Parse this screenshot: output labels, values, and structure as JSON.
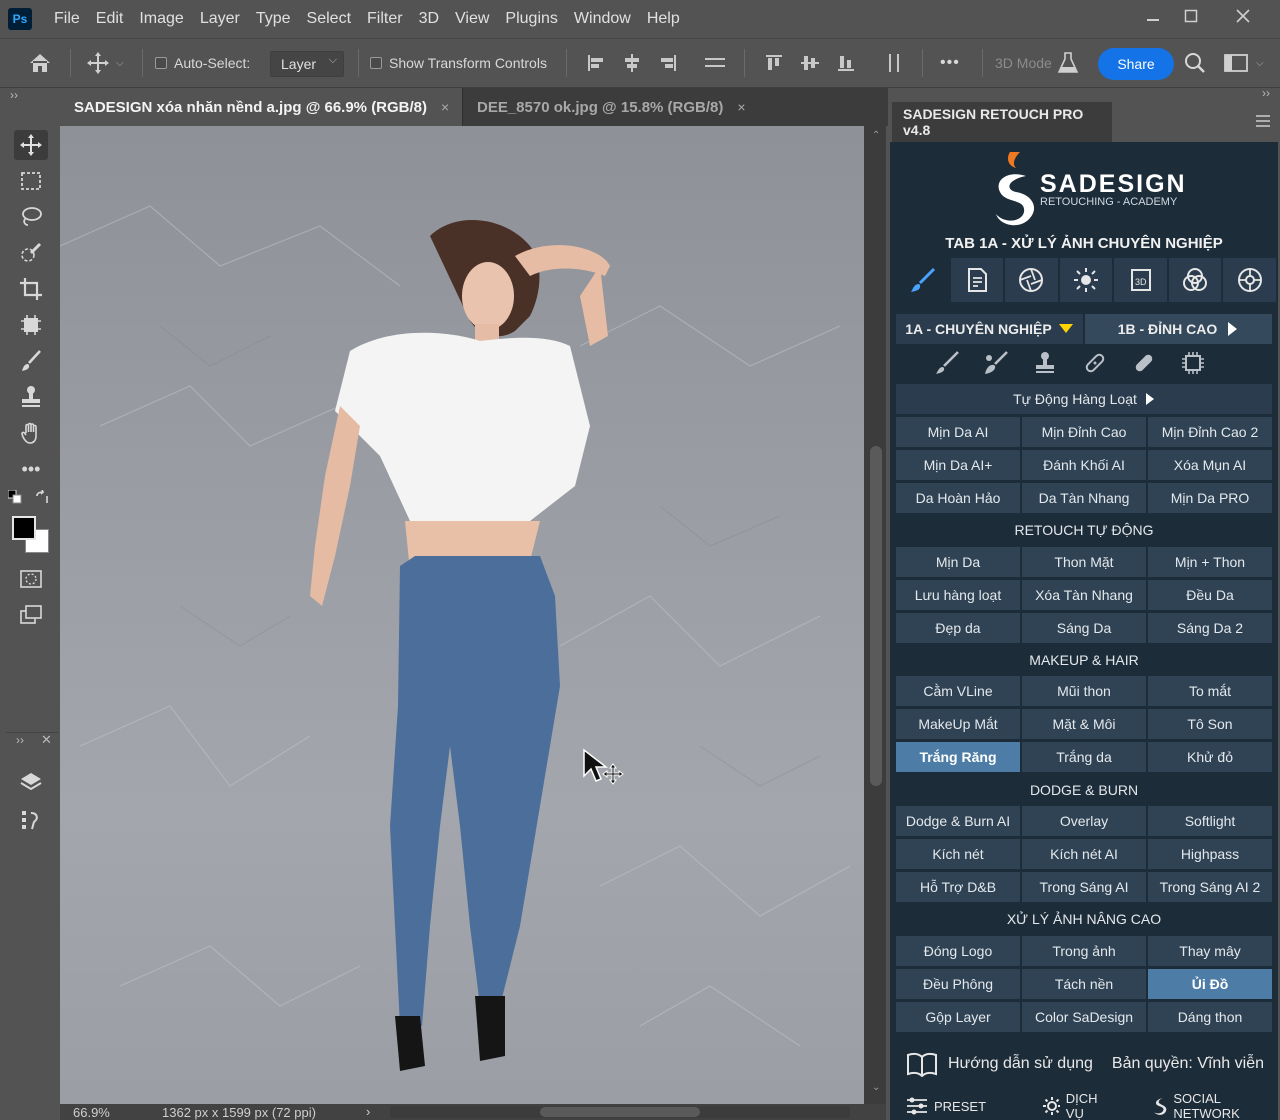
{
  "menubar": {
    "logo": "Ps",
    "items": [
      "File",
      "Edit",
      "Image",
      "Layer",
      "Type",
      "Select",
      "Filter",
      "3D",
      "View",
      "Plugins",
      "Window",
      "Help"
    ]
  },
  "options": {
    "auto_select": "Auto-Select:",
    "layer_dropdown": "Layer",
    "show_transform": "Show Transform Controls",
    "more": "•••",
    "mode_3d": "3D Mode",
    "share": "Share"
  },
  "tabs": [
    {
      "label": "SADESIGN xóa nhăn nềnd a.jpg @ 66.9% (RGB/8)",
      "close": "×"
    },
    {
      "label": "DEE_8570 ok.jpg @ 15.8% (RGB/8)",
      "close": "×"
    }
  ],
  "status": {
    "zoom": "66.9%",
    "dims": "1362 px x 1599 px (72 ppi)",
    "arrow": "›"
  },
  "panel": {
    "title": "SADESIGN RETOUCH PRO v4.8",
    "brand": "SADESIGN",
    "brand_sub": "RETOUCHING - ACADEMY",
    "tab_title": "TAB 1A - XỬ LÝ ẢNH CHUYÊN NGHIỆP",
    "subtab_a": "1A - CHUYÊN NGHIỆP",
    "subtab_b": "1B - ĐỈNH CAO",
    "auto_batch": "Tự Động Hàng Loạt",
    "rows1": [
      [
        "Mịn Da AI",
        "Mịn Đỉnh Cao",
        "Mịn Đỉnh Cao 2"
      ],
      [
        "Mịn Da AI+",
        "Đánh Khối AI",
        "Xóa Mụn AI"
      ],
      [
        "Da Hoàn Hảo",
        "Da Tàn Nhang",
        "Mịn Da PRO"
      ]
    ],
    "sec_retouch": "RETOUCH TỰ ĐỘNG",
    "rows2": [
      [
        "Mịn Da",
        "Thon Mặt",
        "Mịn + Thon"
      ],
      [
        "Lưu hàng loạt",
        "Xóa Tàn Nhang",
        "Đều Da"
      ],
      [
        "Đẹp da",
        "Sáng Da",
        "Sáng Da 2"
      ]
    ],
    "sec_makeup": "MAKEUP & HAIR",
    "rows3": [
      [
        "Cằm VLine",
        "Mũi thon",
        "To mắt"
      ],
      [
        "MakeUp Mắt",
        "Mặt & Môi",
        "Tô Son"
      ],
      [
        "Trắng Răng",
        "Trắng da",
        "Khử đỏ"
      ]
    ],
    "sec_dodge": "DODGE & BURN",
    "rows4": [
      [
        "Dodge & Burn AI",
        "Overlay",
        "Softlight"
      ],
      [
        "Kích nét",
        "Kích nét AI",
        "Highpass"
      ],
      [
        "Hỗ Trợ D&B",
        "Trong Sáng AI",
        "Trong Sáng AI 2"
      ]
    ],
    "sec_adv": "XỬ LÝ ẢNH NÂNG CAO",
    "rows5": [
      [
        "Đóng Logo",
        "Trong ảnh",
        "Thay mây"
      ],
      [
        "Đều Phông",
        "Tách nền",
        "Ủi Đồ"
      ],
      [
        "Gộp Layer",
        "Color SaDesign",
        "Dáng thon"
      ]
    ],
    "guide": "Hướng dẫn sử dụng",
    "license": "Bản quyền: Vĩnh viễn",
    "preset": "PRESET",
    "service": "DỊCH VỤ",
    "social": "SOCIAL NETWORK"
  },
  "colors": {
    "panel_bg": "#1d2c39",
    "button": "#2f4354",
    "active": "#4d7da6",
    "accent_share": "#1473e6",
    "subtab_arrow": "#ffd400"
  }
}
